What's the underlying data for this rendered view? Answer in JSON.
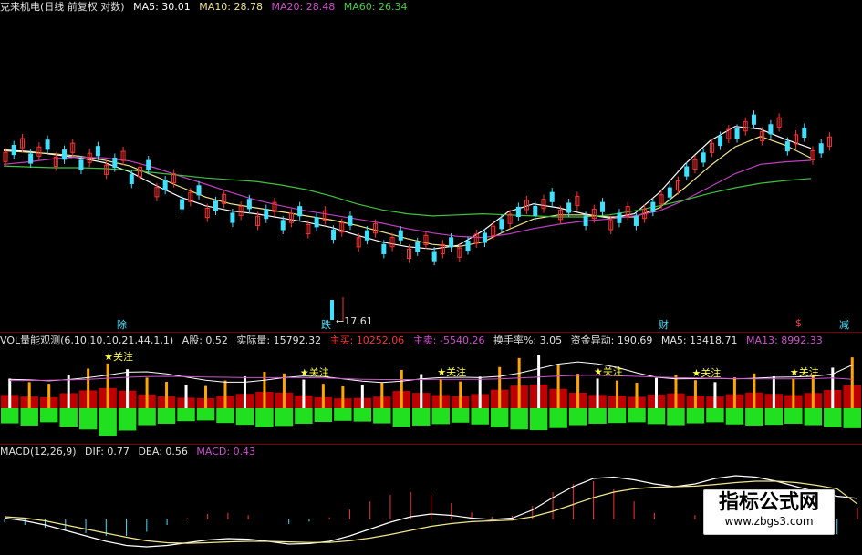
{
  "price_header": {
    "name": "克来机电(日线 前复权 对数)",
    "ma5": "MA5: 30.01",
    "ma10": "MA10: 28.78",
    "ma20": "MA20: 28.48",
    "ma60": "MA60: 26.34"
  },
  "vol_header": {
    "name": "VOL量能观测(6,10,10,10,21,44,1,1)",
    "a_shares": "A股: 0.52",
    "actual_vol": "实际量: 15792.32",
    "main_buy": "主买: 10252.06",
    "main_sell": "主卖: -5540.26",
    "turnover": "换手率%: 3.05",
    "fund_move": "资金异动: 190.69",
    "ma5": "MA5: 13418.71",
    "ma13": "MA13: 8992.33"
  },
  "macd_header": {
    "name": "MACD(12,26,9)",
    "dif": "DIF: 0.77",
    "dea": "DEA: 0.56",
    "macd": "MACD: 0.43"
  },
  "markers": {
    "low_price": "←17.61",
    "m1": "除",
    "m2": "跌",
    "m3": "财",
    "m4": "$",
    "m5": "减",
    "focus": "关注"
  },
  "watermark": {
    "title": "指标公式网",
    "url": "www.zbgs3.com"
  },
  "colors": {
    "up": "#ff3030",
    "down": "#40e0ff",
    "ma5": "#ffffff",
    "ma10": "#f0e68c",
    "ma20": "#c040c0",
    "ma60": "#40c040",
    "vol_up": "#ffa500",
    "vol_green": "#20e020"
  },
  "chart_data": [
    {
      "type": "line",
      "title": "克来机电(日线 前复权 对数)",
      "scale": "log",
      "series": [
        {
          "name": "MA5",
          "color": "#ffffff",
          "values": [
            29.8,
            29.6,
            29.2,
            28.8,
            28.2,
            27.1,
            25.6,
            24.3,
            23.4,
            22.9,
            22.6,
            22.2,
            21.8,
            21.3,
            20.6,
            20.0,
            19.6,
            19.4,
            19.7,
            21.0,
            22.8,
            23.6,
            23.2,
            22.6,
            22.2,
            22.6,
            24.8,
            28.0,
            31.0,
            33.0,
            32.6,
            31.2,
            30.01
          ]
        },
        {
          "name": "MA10",
          "color": "#f0e68c",
          "values": [
            29.7,
            29.5,
            29.3,
            29.0,
            28.5,
            27.8,
            26.6,
            25.4,
            24.3,
            23.6,
            23.2,
            22.8,
            22.4,
            22.0,
            21.5,
            20.9,
            20.3,
            19.8,
            19.6,
            20.0,
            21.1,
            22.1,
            22.5,
            22.5,
            22.3,
            22.3,
            23.2,
            25.3,
            27.8,
            30.2,
            31.6,
            30.4,
            28.78
          ]
        },
        {
          "name": "MA20",
          "color": "#c040c0",
          "values": [
            28.0,
            28.3,
            28.7,
            28.9,
            28.8,
            28.4,
            27.6,
            26.6,
            25.7,
            24.8,
            24.0,
            23.4,
            22.9,
            22.5,
            22.1,
            21.7,
            21.2,
            20.8,
            20.5,
            20.4,
            20.7,
            21.2,
            21.6,
            21.9,
            22.1,
            22.4,
            22.9,
            24.0,
            25.4,
            26.9,
            28.0,
            28.3,
            28.48
          ]
        },
        {
          "name": "MA60",
          "color": "#40c040",
          "values": [
            27.8,
            27.7,
            27.6,
            27.6,
            27.5,
            27.3,
            27.0,
            26.7,
            26.4,
            26.2,
            26.0,
            25.6,
            25.1,
            24.4,
            23.6,
            23.0,
            22.6,
            22.4,
            22.5,
            22.6,
            22.5,
            22.4,
            22.3,
            22.3,
            22.5,
            22.9,
            23.4,
            24.0,
            24.7,
            25.3,
            25.8,
            26.1,
            26.34
          ]
        }
      ],
      "annotations": [
        "←17.61"
      ]
    },
    {
      "type": "bar",
      "title": "VOL量能观测(6,10,10,10,21,44,1,1)",
      "series": [
        {
          "name": "实际量",
          "values": [
            9200,
            8100,
            7600,
            10400,
            12300,
            13900,
            12100,
            9500,
            8200,
            7300,
            6900,
            8600,
            9900,
            11300,
            10800,
            8900,
            7600,
            6800,
            7100,
            8000,
            11900,
            10600,
            9100,
            8300,
            9800,
            12800,
            15600,
            16400,
            13300,
            10700,
            9200,
            8600,
            7900,
            9400,
            10300,
            8700,
            8100,
            9600,
            10800,
            9900,
            9100,
            10500,
            12600,
            15792.32
          ]
        },
        {
          "name": "主卖",
          "values": [
            -4200,
            -4800,
            -3900,
            -5100,
            -5900,
            -7600,
            -6200,
            -4700,
            -4300,
            -3600,
            -3400,
            -4100,
            -4600,
            -5200,
            -4900,
            -4300,
            -3800,
            -3500,
            -3700,
            -4200,
            -5100,
            -4800,
            -4400,
            -4000,
            -4500,
            -5300,
            -5900,
            -6100,
            -5500,
            -4700,
            -4300,
            -4100,
            -3900,
            -4400,
            -4700,
            -4200,
            -3900,
            -4500,
            -4800,
            -4600,
            -4300,
            -4700,
            -5200,
            -5540.26
          ]
        }
      ],
      "lines": [
        {
          "name": "MA5",
          "values": [
            9000,
            8800,
            8500,
            8900,
            9500,
            10300,
            11200,
            11300,
            10700,
            9700,
            8700,
            8100,
            8100,
            8700,
            9500,
            10000,
            9800,
            9100,
            8400,
            8000,
            8400,
            9100,
            9500,
            9600,
            9500,
            9900,
            10900,
            12300,
            13700,
            14400,
            13800,
            12700,
            11000,
            9600,
            9100,
            9200,
            9300,
            9100,
            9300,
            9600,
            9700,
            9900,
            10600,
            13418.71
          ]
        },
        {
          "name": "MA13",
          "values": [
            8600,
            8600,
            8700,
            8800,
            9000,
            9300,
            9600,
            9800,
            9900,
            9800,
            9700,
            9600,
            9500,
            9500,
            9500,
            9500,
            9400,
            9200,
            9000,
            8900,
            8900,
            8900,
            9000,
            9000,
            9000,
            9100,
            9400,
            9700,
            10000,
            10200,
            10200,
            10100,
            9900,
            9700,
            9500,
            9400,
            9300,
            9200,
            9100,
            9100,
            9100,
            9200,
            9400,
            8992.33
          ]
        }
      ],
      "focus_markers": [
        "关注",
        "关注",
        "关注",
        "关注",
        "关注",
        "关注"
      ]
    },
    {
      "type": "line",
      "title": "MACD(12,26,9)",
      "series": [
        {
          "name": "DIF",
          "color": "#ffffff",
          "values": [
            0.05,
            -0.05,
            -0.2,
            -0.4,
            -0.6,
            -0.8,
            -0.95,
            -1.0,
            -0.95,
            -0.85,
            -0.75,
            -0.7,
            -0.72,
            -0.8,
            -0.9,
            -0.88,
            -0.8,
            -0.6,
            -0.35,
            -0.1,
            0.1,
            0.2,
            0.15,
            0.05,
            0.0,
            0.05,
            0.35,
            0.8,
            1.2,
            1.5,
            1.55,
            1.45,
            1.3,
            1.2,
            1.3,
            1.5,
            1.6,
            1.55,
            1.4,
            1.2,
            1.0,
            0.85,
            0.77
          ]
        },
        {
          "name": "DEA",
          "color": "#f0e68c",
          "values": [
            0.1,
            0.05,
            -0.05,
            -0.2,
            -0.35,
            -0.5,
            -0.65,
            -0.78,
            -0.85,
            -0.87,
            -0.85,
            -0.82,
            -0.8,
            -0.8,
            -0.82,
            -0.84,
            -0.84,
            -0.78,
            -0.68,
            -0.55,
            -0.4,
            -0.25,
            -0.15,
            -0.08,
            -0.05,
            -0.02,
            0.1,
            0.3,
            0.55,
            0.8,
            1.0,
            1.12,
            1.18,
            1.2,
            1.22,
            1.28,
            1.35,
            1.4,
            1.4,
            1.35,
            1.25,
            1.12,
            0.56
          ]
        },
        {
          "name": "MACD",
          "color": "#ff3030",
          "values": [
            -0.1,
            -0.2,
            -0.3,
            -0.4,
            -0.5,
            -0.6,
            -0.6,
            -0.45,
            -0.2,
            0.05,
            0.2,
            0.24,
            0.16,
            0.0,
            -0.16,
            -0.08,
            0.08,
            0.36,
            0.66,
            0.9,
            1.0,
            0.9,
            0.6,
            0.26,
            0.1,
            0.14,
            0.5,
            1.0,
            1.3,
            1.4,
            1.1,
            0.66,
            0.24,
            0.0,
            0.16,
            0.44,
            0.5,
            0.3,
            0.0,
            -0.3,
            -0.5,
            -0.54,
            0.43
          ]
        }
      ]
    }
  ]
}
